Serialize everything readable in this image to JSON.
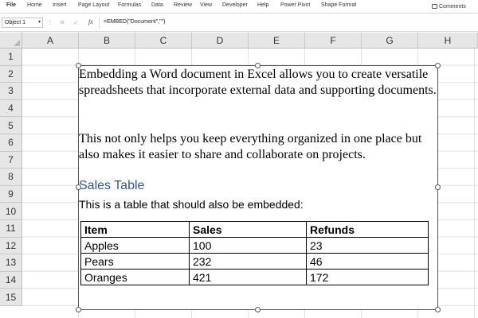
{
  "ribbon": {
    "tabs": [
      "File",
      "Home",
      "Insert",
      "Page Layout",
      "Formulas",
      "Data",
      "Review",
      "View",
      "Developer",
      "Help",
      "Power Pivot",
      "Shape Format"
    ],
    "comments_label": "Comments"
  },
  "formula_bar": {
    "name_box": "Object 1",
    "cancel_icon": "✕",
    "enter_icon": "✓",
    "fx_label": "fx",
    "formula": "=EMBED(\"Document\",\"\")"
  },
  "grid": {
    "columns": [
      "A",
      "B",
      "C",
      "D",
      "E",
      "F",
      "G",
      "H"
    ],
    "rows": [
      "1",
      "2",
      "3",
      "4",
      "5",
      "6",
      "7",
      "8",
      "9",
      "10",
      "11",
      "12",
      "13",
      "14",
      "15"
    ]
  },
  "document": {
    "paragraph1": "Embedding a Word document in Excel allows you to create versatile spreadsheets that incorporate external data and supporting documents.",
    "paragraph2": "This not only helps you keep everything organized in one place but also makes it easier to share and collaborate on projects.",
    "heading": "Sales Table",
    "intro": "This is a table that should also be embedded:",
    "table": {
      "headers": [
        "Item",
        "Sales",
        "Refunds"
      ],
      "rows": [
        [
          "Apples",
          "100",
          "23"
        ],
        [
          "Pears",
          "232",
          "46"
        ],
        [
          "Oranges",
          "421",
          "172"
        ]
      ]
    }
  },
  "colors": {
    "heading": "#2f5496",
    "header_bg": "#e6e6e6",
    "gridline": "#e0e0e0"
  }
}
